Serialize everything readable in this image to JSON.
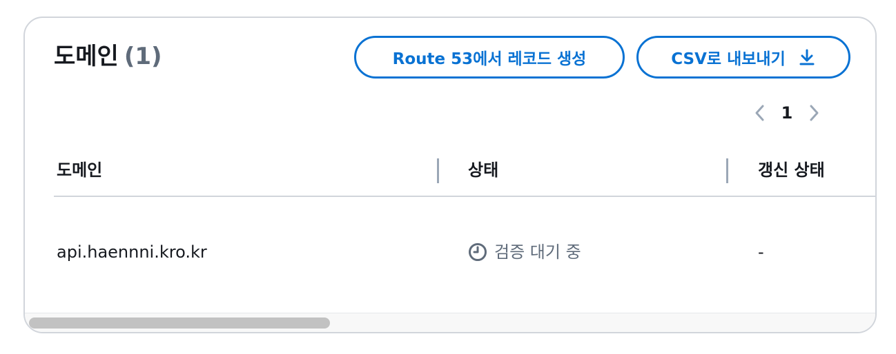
{
  "panel": {
    "title": "도메인",
    "count": "(1)"
  },
  "actions": {
    "route53_label": "Route 53에서 레코드 생성",
    "csv_label": "CSV로 내보내기",
    "csv_icon": "download-icon"
  },
  "pagination": {
    "current_page": "1",
    "prev_icon": "chevron-left-icon",
    "next_icon": "chevron-right-icon"
  },
  "table": {
    "columns": [
      "도메인",
      "상태",
      "갱신 상태"
    ],
    "rows": [
      {
        "domain": "api.haennni.kro.kr",
        "status": "검증 대기 중",
        "status_icon": "clock-icon",
        "renewal_status": "-"
      }
    ]
  },
  "colors": {
    "accent": "#0972d3",
    "text": "#16191f",
    "muted": "#5f6b7a",
    "border": "#d1d5db"
  }
}
